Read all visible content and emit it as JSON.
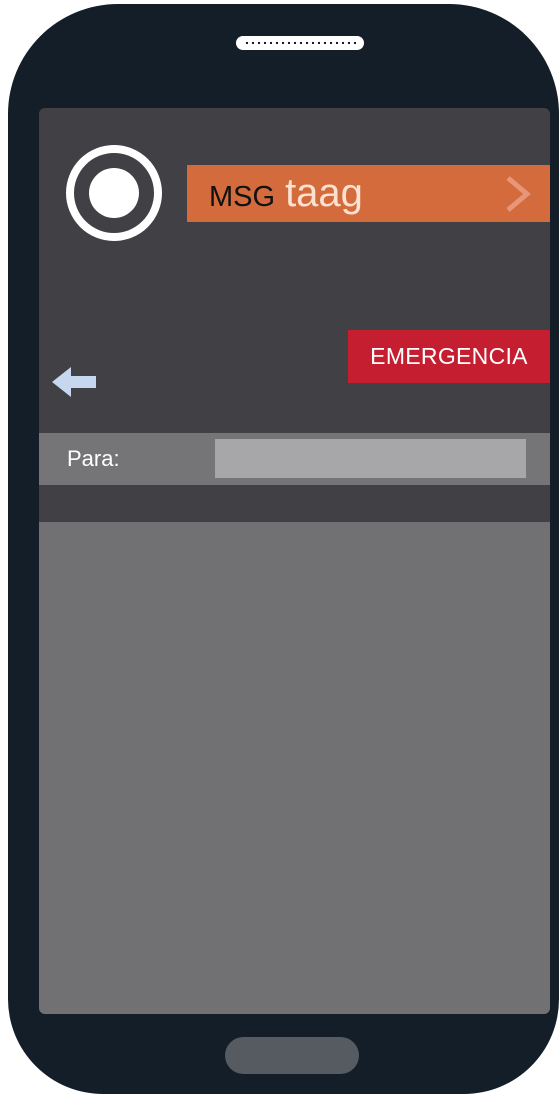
{
  "header": {
    "brand_prefix": "MSG",
    "brand_name": "taag",
    "logo_icon": "target-ring-icon",
    "chevron_icon": "chevron-right-icon"
  },
  "nav": {
    "back_icon": "arrow-left-icon"
  },
  "emergency": {
    "label": "EMERGENCIA"
  },
  "compose": {
    "to_label": "Para:",
    "to_value": "",
    "to_placeholder": ""
  },
  "colors": {
    "brand_orange": "#d46b3c",
    "emergency_red": "#c41e30",
    "screen_bg": "#414045",
    "phone_body": "#141e28",
    "back_arrow": "#c7d7f0"
  }
}
